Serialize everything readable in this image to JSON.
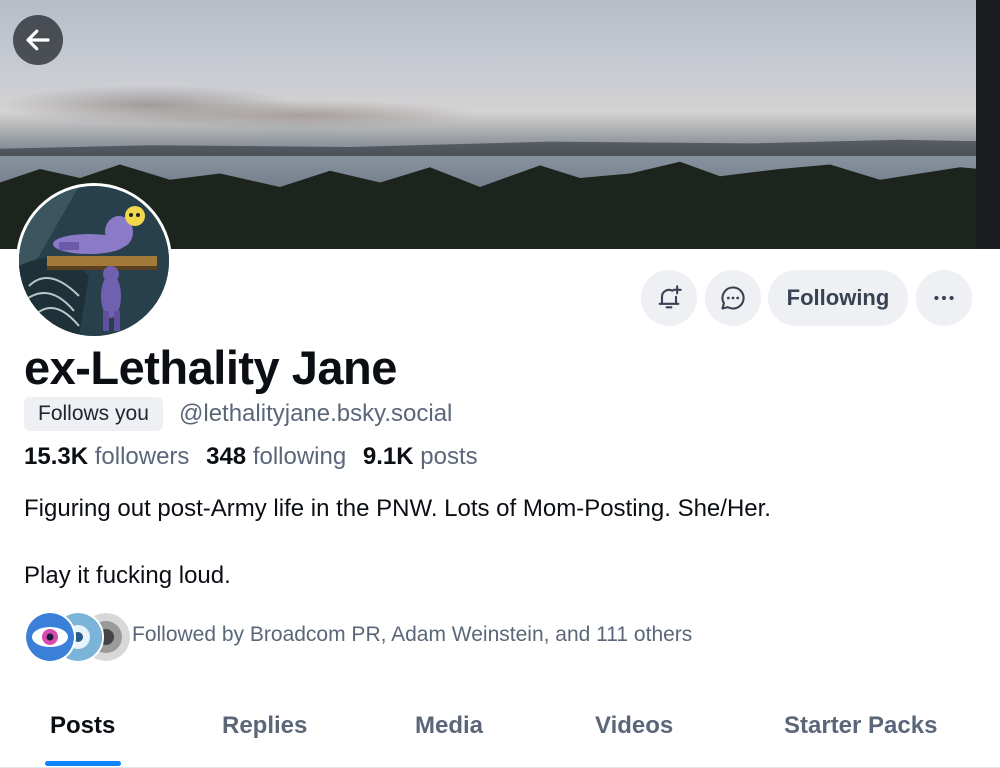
{
  "header": {
    "back_icon": "arrow-left-icon"
  },
  "profile": {
    "display_name": "ex-Lethality Jane",
    "follows_you_badge": "Follows you",
    "handle": "@lethalityjane.bsky.social",
    "stats": {
      "followers_count": "15.3K",
      "followers_label": "followers",
      "following_count": "348",
      "following_label": "following",
      "posts_count": "9.1K",
      "posts_label": "posts"
    },
    "bio_line1": "Figuring out post-Army life in the PNW. Lots of Mom-Posting. She/Her.",
    "bio_line2": "Play it fucking loud.",
    "followed_by_text": "Followed by Broadcom PR, Adam Weinstein, and 111 others"
  },
  "actions": {
    "subscribe_icon": "bell-plus-icon",
    "message_icon": "chat-bubble-icon",
    "following_label": "Following",
    "more_icon": "ellipsis-icon"
  },
  "tabs": [
    {
      "label": "Posts",
      "active": true
    },
    {
      "label": "Replies",
      "active": false
    },
    {
      "label": "Media",
      "active": false
    },
    {
      "label": "Videos",
      "active": false
    },
    {
      "label": "Starter Packs",
      "active": false
    }
  ],
  "colors": {
    "accent": "#1083fe",
    "button_bg": "#eef0f3",
    "muted_text": "#5b6779"
  }
}
